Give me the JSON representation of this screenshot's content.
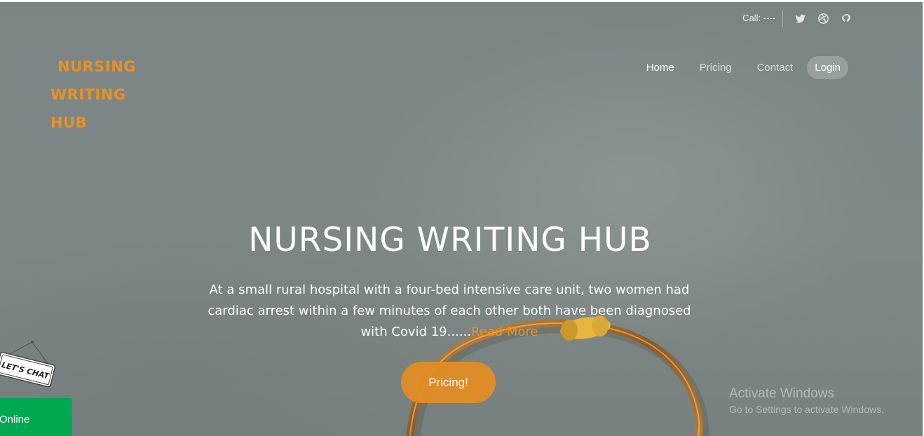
{
  "topbar": {
    "call": "Call: ----"
  },
  "social": [
    "twitter-icon",
    "dribbble-icon",
    "github-icon"
  ],
  "logo": {
    "line1": "NURSING",
    "line2": "WRITING",
    "line3": "HUB"
  },
  "nav": {
    "home": "Home",
    "pricing": "Pricing",
    "contact": "Contact",
    "login": "Login"
  },
  "hero": {
    "title": "NURSING WRITING HUB",
    "description": "At a small rural hospital with a four-bed intensive care unit, two women had cardiac arrest within a few minutes of each other both have been diagnosed with Covid 19......",
    "read_more": "Read More",
    "cta": "Pricing!"
  },
  "chat": {
    "sign": "LET'S CHAT",
    "status": "Online"
  },
  "watermark": {
    "line1": "Activate Windows",
    "line2": "Go to Settings to activate Windows."
  },
  "colors": {
    "accent": "#e89124",
    "online": "#00a94f",
    "hero_bg": "#7b8484"
  }
}
